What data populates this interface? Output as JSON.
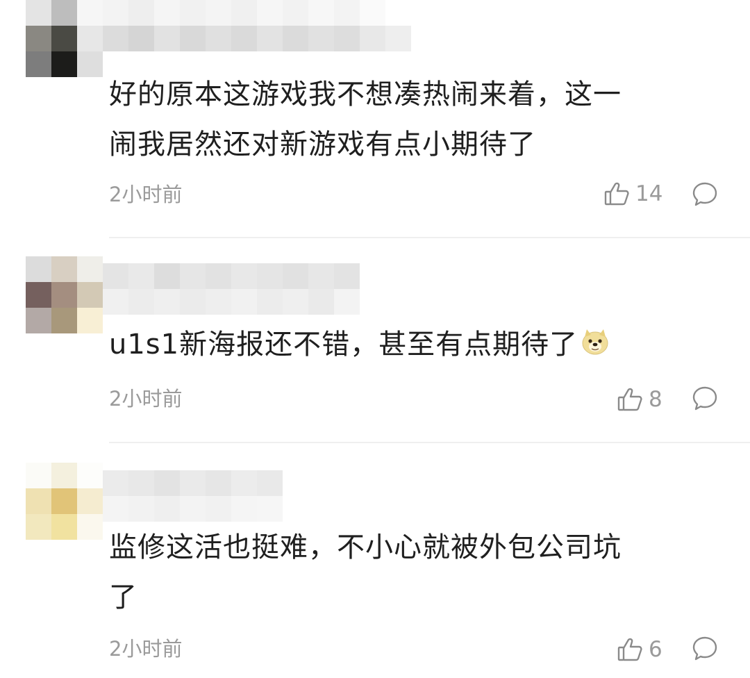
{
  "comments": [
    {
      "text_line1": "好的原本这游戏我不想凑热闹来着，这一",
      "text_line2": "闹我居然还对新游戏有点小期待了",
      "time": "2小时前",
      "likes": "14"
    },
    {
      "text_line1": "u1s1新海报还不错，甚至有点期待了",
      "emoji": "doge-emoji",
      "time": "2小时前",
      "likes": "8"
    },
    {
      "text_line1": "监修这活也挺难，不小心就被外包公司坑",
      "text_line2": "了",
      "time": "2小时前",
      "likes": "6"
    }
  ],
  "icons": {
    "like": "thumbs-up-icon",
    "reply": "comment-bubble-icon"
  },
  "colors": {
    "meta_text": "#9a9a9a",
    "body_text": "#1f1f1f",
    "divider": "#efefef"
  }
}
